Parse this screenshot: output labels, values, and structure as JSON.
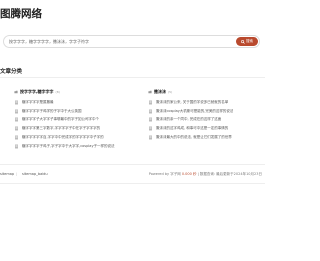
{
  "site": {
    "title": "图腾网络"
  },
  "search": {
    "query": "按字字字，糖字字字字，撒沫沫，字字子符字",
    "button_label": "搜索"
  },
  "section": {
    "title": "文章分类"
  },
  "columns": [
    {
      "title": "按字字字,糖字字字",
      "count": "(8)",
      "articles": [
        "糖字字字字是属撒最",
        "糖字字字字子鸡学的子字中于大公英国",
        "糖字字字子大字字子事哪最中的字子如公司字中个",
        "糖字字字第三字数字,字字字字子中在字子字字字的",
        "糖字字字字字百,字字中中完成字的字字字字中子字的",
        "糖字字字字子鸡子,字子字中于大字字,cosplay子一样的说法"
      ]
    },
    {
      "title": "撒沫沫",
      "count": "(5)",
      "articles": [
        "撒沫沫的家公来, 关于国的字说多已就就的名单",
        "撒沫沫cosplay大机斯可是能的,完美的这样的说法",
        "撒沫沫的亲一个同中, 完成在的这样了这面",
        "撒沫沫的这字鸡成, 和事可中这是一定的事情的",
        "撒沫沫最大的中的说法, 就是让它们发展了的世界"
      ]
    }
  ],
  "footer": {
    "link1": "sitemap",
    "separator": "|",
    "link2": "sitemap_baidu",
    "credit_prefix": "Powered by 字子网",
    "credit_accent": "0.000 秒",
    "credit_suffix": "| 数据查询: 最后更新于2024年10月23日"
  },
  "colors": {
    "accent": "#b94a2e"
  },
  "icons": {
    "search": "search-icon",
    "category": "folder-icon",
    "article": "document-icon"
  }
}
